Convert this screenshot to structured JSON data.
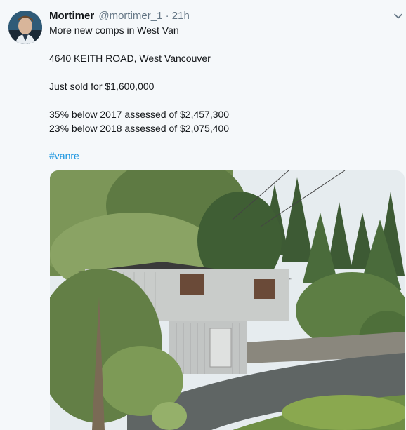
{
  "tweet": {
    "author_name": "Mortimer",
    "handle": "@mortimer_1",
    "separator": "·",
    "time": "21h",
    "lines": [
      "More new comps in West Van",
      "4640 KEITH ROAD, West Vancouver",
      "Just sold for $1,600,000",
      "35% below 2017 assessed of $2,457,300",
      "23% below 2018 assessed of $2,075,400"
    ],
    "hashtag": "#vanre",
    "icons": {
      "menu": "chevron-down-icon",
      "avatar": "avatar-photo"
    },
    "colors": {
      "link": "#1b95e0",
      "secondary_text": "#657786",
      "background": "#f5f8fa"
    }
  }
}
